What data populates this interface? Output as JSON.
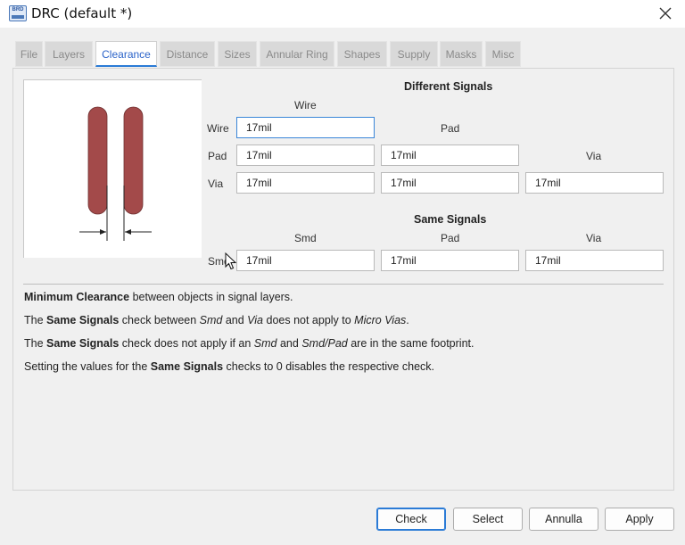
{
  "window": {
    "title": "DRC (default *)",
    "icon_text": "BRD"
  },
  "tabs": [
    {
      "label": "File",
      "active": false
    },
    {
      "label": "Layers",
      "active": false
    },
    {
      "label": "Clearance",
      "active": true
    },
    {
      "label": "Distance",
      "active": false
    },
    {
      "label": "Sizes",
      "active": false
    },
    {
      "label": "Annular Ring",
      "active": false
    },
    {
      "label": "Shapes",
      "active": false
    },
    {
      "label": "Supply",
      "active": false
    },
    {
      "label": "Masks",
      "active": false
    },
    {
      "label": "Misc",
      "active": false
    }
  ],
  "different_signals": {
    "heading": "Different Signals",
    "col_wire": "Wire",
    "col_pad": "Pad",
    "col_via": "Via",
    "row_wire": "Wire",
    "row_pad": "Pad",
    "row_via": "Via",
    "wire_wire": "17mil",
    "pad_wire": "17mil",
    "pad_pad": "17mil",
    "via_wire": "17mil",
    "via_pad": "17mil",
    "via_via": "17mil"
  },
  "same_signals": {
    "heading": "Same Signals",
    "col_smd": "Smd",
    "col_pad": "Pad",
    "col_via": "Via",
    "row_smd": "Smd",
    "smd_smd": "17mil",
    "smd_pad": "17mil",
    "smd_via": "17mil"
  },
  "description": {
    "line1_bold": "Minimum Clearance",
    "line1_rest": " between objects in signal layers.",
    "line2_a": "The ",
    "line2_bold": "Same Signals",
    "line2_b": " check between ",
    "line2_i1": "Smd",
    "line2_c": " and ",
    "line2_i2": "Via",
    "line2_d": " does not apply to ",
    "line2_i3": "Micro Vias",
    "line2_e": ".",
    "line3_a": "The ",
    "line3_bold": "Same Signals",
    "line3_b": " check does not apply if an ",
    "line3_i1": "Smd",
    "line3_c": " and ",
    "line3_i2": "Smd/Pad",
    "line3_d": " are in the same footprint.",
    "line4_a": "Setting the values for the ",
    "line4_bold": "Same Signals",
    "line4_b": " checks to 0 disables the respective check."
  },
  "buttons": {
    "check": "Check",
    "select": "Select",
    "cancel": "Annulla",
    "apply": "Apply"
  },
  "colors": {
    "accent": "#2b7bd6",
    "trace": "#a34a4a"
  },
  "icons": {
    "close": "close-icon",
    "cursor": "mouse-pointer-icon"
  }
}
